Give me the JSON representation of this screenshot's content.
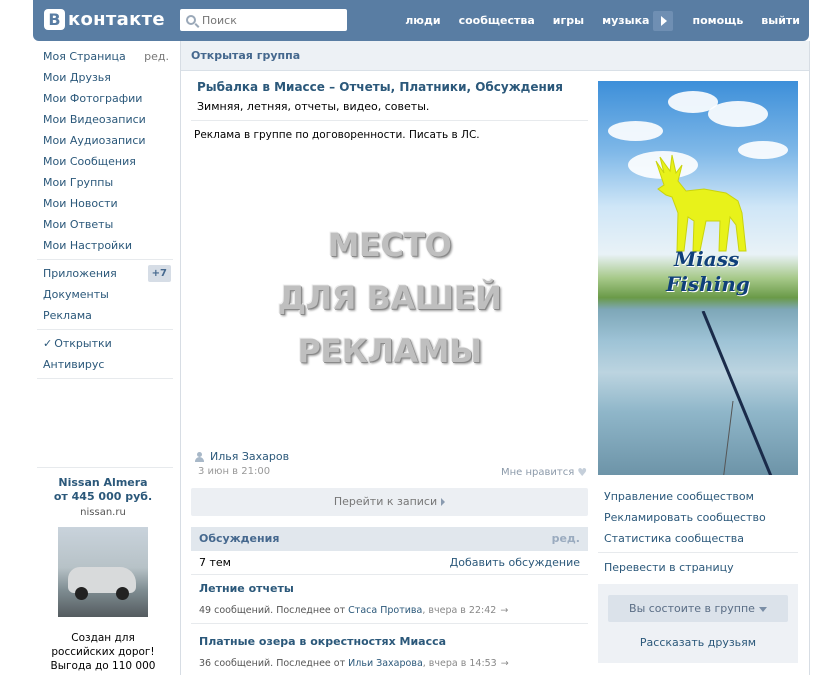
{
  "header": {
    "logo_letter": "В",
    "logo_text": "контакте",
    "search_placeholder": "Поиск",
    "nav": [
      "люди",
      "сообщества",
      "игры",
      "музыка",
      "помощь",
      "выйти"
    ]
  },
  "sidebar": {
    "items": [
      {
        "label": "Моя Страница",
        "extra": "ред."
      },
      {
        "label": "Мои Друзья"
      },
      {
        "label": "Мои Фотографии"
      },
      {
        "label": "Мои Видеозаписи"
      },
      {
        "label": "Мои Аудиозаписи"
      },
      {
        "label": "Мои Сообщения"
      },
      {
        "label": "Мои Группы"
      },
      {
        "label": "Мои Новости"
      },
      {
        "label": "Мои Ответы"
      },
      {
        "label": "Мои Настройки"
      }
    ],
    "apps": [
      {
        "label": "Приложения",
        "badge": "+7"
      },
      {
        "label": "Документы"
      },
      {
        "label": "Реклама"
      }
    ],
    "extra": [
      {
        "label": "Открытки",
        "check": "✓"
      },
      {
        "label": "Антивирус"
      }
    ],
    "ad": {
      "title_line1": "Nissan Almera",
      "title_line2": "от 445 000 руб.",
      "domain": "nissan.ru",
      "text_line1": "Создан для",
      "text_line2": "российских дорог!",
      "text_line3": "Выгода до 110 000"
    }
  },
  "content": {
    "page_label": "Открытая группа",
    "group_title": "Рыбалка в Миассе – Отчеты, Платники, Обсуждения",
    "group_subtitle": "Зимняя, летняя, отчеты, видео, советы.",
    "ad_note": "Реклама в группе по договоренности. Писать в ЛС.",
    "big_text": [
      "МЕСТО",
      "ДЛЯ ВАШЕЙ",
      "РЕКЛАМЫ"
    ],
    "author": "Илья Захаров",
    "date": "3 июн в 21:00",
    "like_label": "Мне нравится",
    "goto_label": "Перейти к записи",
    "discussions": {
      "title": "Обсуждения",
      "edit": "ред.",
      "count": "7 тем",
      "add": "Добавить обсуждение",
      "topics": [
        {
          "title": "Летние отчеты",
          "meta_prefix": "49 сообщений. Последнее от ",
          "who": "Стаса Протива",
          "when": ", вчера в 22:42",
          "arrow": "→"
        },
        {
          "title": "Платные озера в окрестностях Миасса",
          "meta_prefix": "36 сообщений. Последнее от ",
          "who": "Ильи Захарова",
          "when": ", вчера в 14:53",
          "arrow": "→"
        }
      ]
    }
  },
  "right": {
    "cover_text_1": "Miass",
    "cover_text_2": "Fishing",
    "links": [
      "Управление сообществом",
      "Рекламировать сообщество",
      "Статистика сообщества"
    ],
    "link_after_sep": "Перевести в страницу",
    "member_button": "Вы состоите в группе",
    "tell_friends": "Рассказать друзьям"
  },
  "colors": {
    "header_bg": "#597da3",
    "link": "#2b587a",
    "accent": "#45688e",
    "moose": "#e8f21a"
  }
}
